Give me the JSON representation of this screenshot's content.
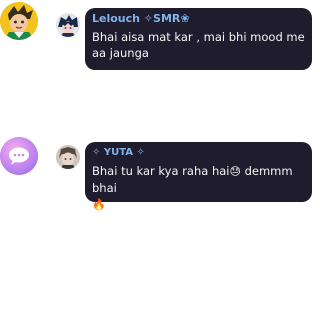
{
  "messages": [
    {
      "author": "Lelouch ✧SMR❀",
      "text": "Bhai aisa mat kar , mai bhi mood me aa jaunga"
    },
    {
      "author": "✧ YUTA ✧",
      "text_before": "Bhai tu kar kya raha hai",
      "emoji": "😓",
      "text_after": " demmm bhai",
      "emoji2": "🔥"
    }
  ],
  "icons": {
    "avatar1": "cartoon-character-avatar",
    "avatar2": "anime-character-avatar",
    "avatar3": "chat-bubble-avatar",
    "avatar4": "anime-character-avatar"
  },
  "colors": {
    "bubble": "#1f1c2e",
    "author": "#7fb3ea",
    "text": "#f4f4f4"
  }
}
